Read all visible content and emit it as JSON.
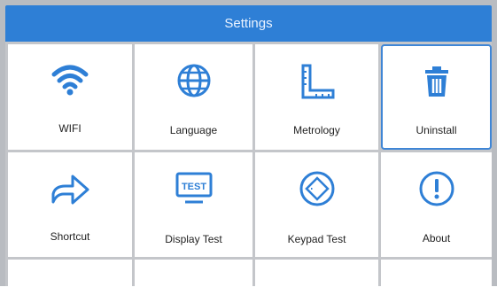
{
  "header": {
    "title": "Settings"
  },
  "accent_color": "#2e7fd6",
  "tiles": [
    {
      "label": "WIFI",
      "icon": "wifi-icon"
    },
    {
      "label": "Language",
      "icon": "globe-icon"
    },
    {
      "label": "Metrology",
      "icon": "ruler-icon"
    },
    {
      "label": "Uninstall",
      "icon": "trash-icon",
      "selected": true
    },
    {
      "label": "Shortcut",
      "icon": "arrow-right-icon"
    },
    {
      "label": "Display Test",
      "icon": "display-test-icon"
    },
    {
      "label": "Keypad Test",
      "icon": "keypad-test-icon"
    },
    {
      "label": "About",
      "icon": "info-icon"
    }
  ]
}
